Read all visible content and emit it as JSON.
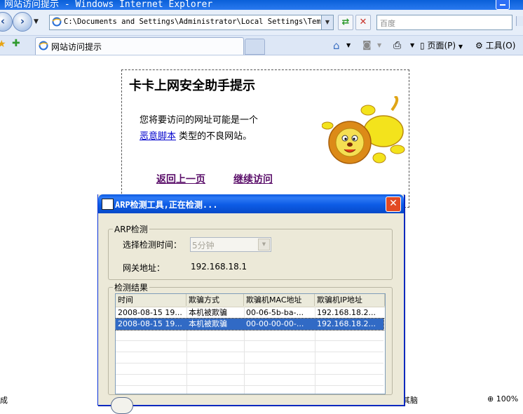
{
  "window": {
    "title": "网站访问提示 - Windows Internet Explorer"
  },
  "toolbar": {
    "address": "C:\\Documents and Settings\\Administrator\\Local Settings\\Temp\\S",
    "search_placeholder": "百度",
    "page_label": "页面(P)",
    "tools_label": "工具(O)"
  },
  "tab": {
    "label": "网站访问提示"
  },
  "page": {
    "title": "卡卡上网安全助手提示",
    "line1": "您将要访问的网址可能是一个",
    "link": "恶意脚本",
    "line2_rest": "类型的不良网站。",
    "back": "返回上一页",
    "continue": "继续访问"
  },
  "status": {
    "left": "成",
    "middle": "其脑",
    "zoom": "100%"
  },
  "dialog": {
    "title": "ARP检测工具,正在检测...",
    "group1": "ARP检测",
    "interval_label": "选择检测时间：",
    "interval_value": "5分钟",
    "gateway_label": "网关地址：",
    "gateway_value": "192.168.18.1",
    "group2": "检测结果",
    "columns": [
      "时间",
      "欺骗方式",
      "欺骗机MAC地址",
      "欺骗机IP地址"
    ],
    "rows": [
      [
        "2008-08-15 19...",
        "本机被欺骗",
        "00-06-5b-ba-...",
        "192.168.18.2..."
      ],
      [
        "2008-08-15 19...",
        "本机被欺骗",
        "00-00-00-00-...",
        "192.168.18.2..."
      ]
    ]
  }
}
